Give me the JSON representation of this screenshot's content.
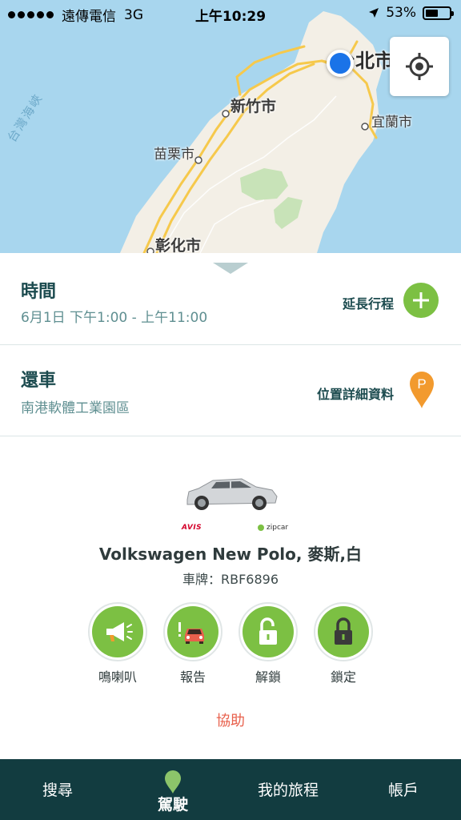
{
  "status_bar": {
    "carrier": "遠傳電信",
    "network": "3G",
    "time": "上午10:29",
    "battery": "53%",
    "battery_level": 0.53
  },
  "map": {
    "labels": {
      "taipei": "台北市",
      "hsinchu": "新竹市",
      "yilan": "宜蘭市",
      "miaoli": "苗栗市",
      "changhua": "彰化市",
      "strait": "台灣海峽"
    },
    "locate_icon": "crosshair-icon"
  },
  "time_row": {
    "title": "時間",
    "range": "6月1日  下午1:00 - 上午11:00",
    "action_label": "延長行程",
    "action_icon": "plus-icon"
  },
  "return_row": {
    "title": "還車",
    "location": "南港軟體工業園區",
    "action_label": "位置詳細資料",
    "pin_letter": "P"
  },
  "car": {
    "name": "Volkswagen New Polo, 麥斯,白",
    "plate": "車牌：RBF6896",
    "brand_avis": "AVIS",
    "brand_zipcar": "zipcar"
  },
  "actions": [
    {
      "label": "鳴喇叭",
      "icon": "megaphone-icon"
    },
    {
      "label": "報告",
      "icon": "car-alert-icon"
    },
    {
      "label": "解鎖",
      "icon": "unlock-icon"
    },
    {
      "label": "鎖定",
      "icon": "lock-icon"
    }
  ],
  "help_label": "協助",
  "tabs": [
    {
      "label": "搜尋"
    },
    {
      "label": "駕駛",
      "active": true
    },
    {
      "label": "我的旅程"
    },
    {
      "label": "帳戶"
    }
  ],
  "colors": {
    "accent_green": "#7cc043",
    "dark_teal": "#123c40",
    "help_red": "#e8604c",
    "pin_orange": "#f29a2e"
  }
}
